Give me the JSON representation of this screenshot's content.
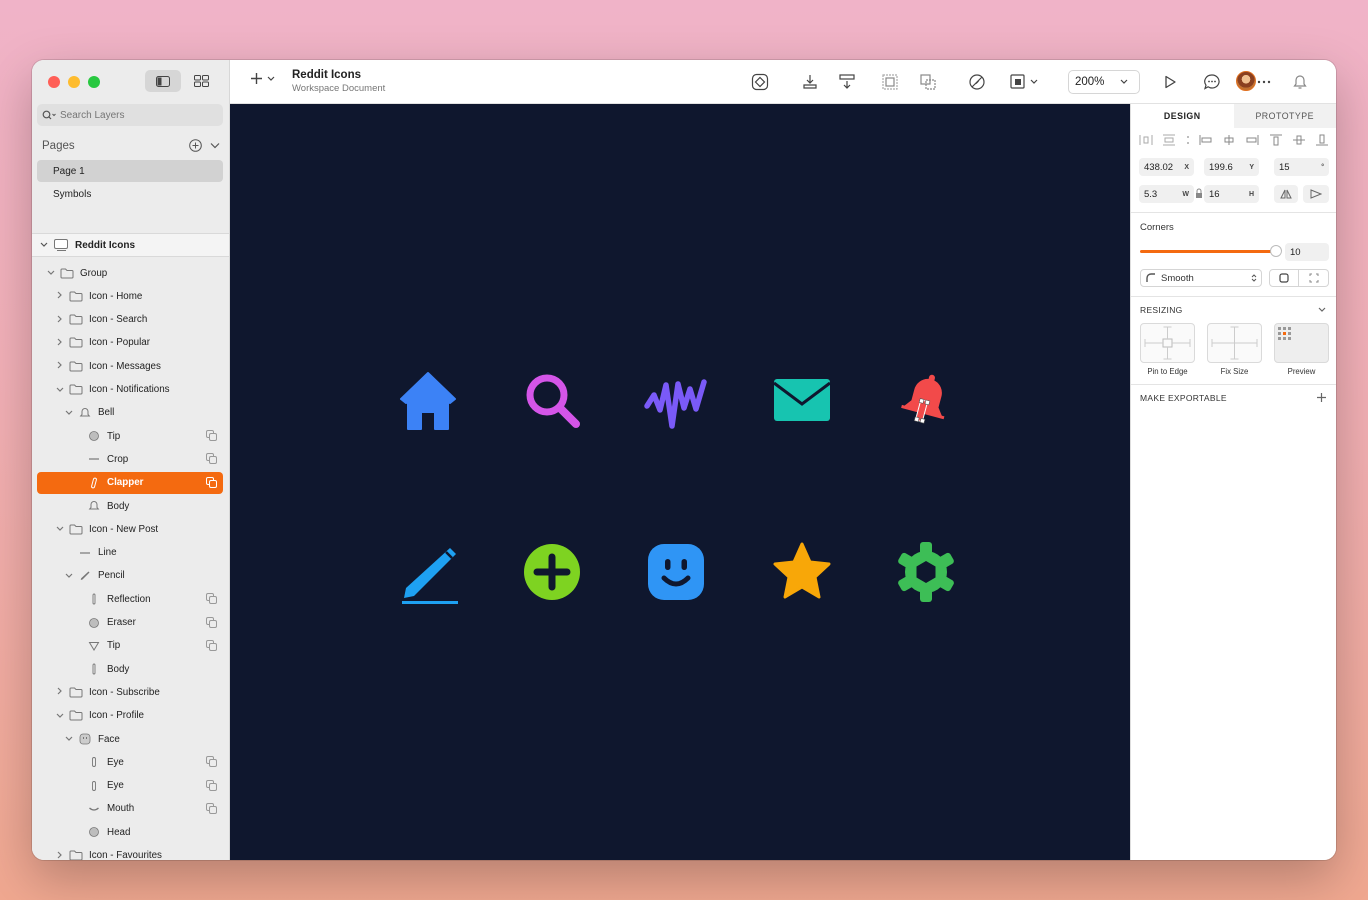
{
  "colors": {
    "accent": "#f46a10",
    "canvas": "#0f172e"
  },
  "sidebar": {
    "search_placeholder": "Search Layers",
    "pages_label": "Pages",
    "pages": [
      {
        "label": "Page 1",
        "selected": true
      },
      {
        "label": "Symbols",
        "selected": false
      }
    ],
    "root_label": "Reddit Icons",
    "layers": [
      {
        "label": "Group",
        "indent": 0,
        "chev": "down",
        "icon": "folder-icon"
      },
      {
        "label": "Icon - Home",
        "indent": 1,
        "chev": "right",
        "icon": "folder-icon"
      },
      {
        "label": "Icon - Search",
        "indent": 1,
        "chev": "right",
        "icon": "folder-icon"
      },
      {
        "label": "Icon - Popular",
        "indent": 1,
        "chev": "right",
        "icon": "folder-icon"
      },
      {
        "label": "Icon - Messages",
        "indent": 1,
        "chev": "right",
        "icon": "folder-icon"
      },
      {
        "label": "Icon - Notifications",
        "indent": 1,
        "chev": "down",
        "icon": "folder-icon"
      },
      {
        "label": "Bell",
        "indent": 2,
        "chev": "down",
        "icon": "bell-icon"
      },
      {
        "label": "Tip",
        "indent": 3,
        "chev": "",
        "icon": "circle-icon",
        "symbol": true
      },
      {
        "label": "Crop",
        "indent": 3,
        "chev": "",
        "icon": "line-icon",
        "symbol": true
      },
      {
        "label": "Clapper",
        "indent": 3,
        "chev": "",
        "icon": "clapper-icon",
        "symbol": true,
        "selected": true
      },
      {
        "label": "Body",
        "indent": 3,
        "chev": "",
        "icon": "bell-icon"
      },
      {
        "label": "Icon - New Post",
        "indent": 1,
        "chev": "down",
        "icon": "folder-icon"
      },
      {
        "label": "Line",
        "indent": 2,
        "chev": "",
        "icon": "line-icon"
      },
      {
        "label": "Pencil",
        "indent": 2,
        "chev": "down",
        "icon": "pencil-icon"
      },
      {
        "label": "Reflection",
        "indent": 3,
        "chev": "",
        "icon": "bar-icon",
        "symbol": true
      },
      {
        "label": "Eraser",
        "indent": 3,
        "chev": "",
        "icon": "circle-icon",
        "symbol": true
      },
      {
        "label": "Tip",
        "indent": 3,
        "chev": "",
        "icon": "triangle-icon",
        "symbol": true
      },
      {
        "label": "Body",
        "indent": 3,
        "chev": "",
        "icon": "bar-icon"
      },
      {
        "label": "Icon - Subscribe",
        "indent": 1,
        "chev": "right",
        "icon": "folder-icon"
      },
      {
        "label": "Icon - Profile",
        "indent": 1,
        "chev": "down",
        "icon": "folder-icon"
      },
      {
        "label": "Face",
        "indent": 2,
        "chev": "down",
        "icon": "face-icon"
      },
      {
        "label": "Eye",
        "indent": 3,
        "chev": "",
        "icon": "eye-icon",
        "symbol": true
      },
      {
        "label": "Eye",
        "indent": 3,
        "chev": "",
        "icon": "eye-icon",
        "symbol": true
      },
      {
        "label": "Mouth",
        "indent": 3,
        "chev": "",
        "icon": "mouth-icon",
        "symbol": true
      },
      {
        "label": "Head",
        "indent": 3,
        "chev": "",
        "icon": "circle-icon"
      },
      {
        "label": "Icon - Favourites",
        "indent": 1,
        "chev": "right",
        "icon": "folder-icon"
      }
    ]
  },
  "toolbar": {
    "title": "Reddit Icons",
    "subtitle": "Workspace Document",
    "zoom": "200%"
  },
  "canvas": {
    "icons": [
      "home-icon",
      "search-icon",
      "popular-icon",
      "messages-icon",
      "notifications-icon",
      "new-post-icon",
      "subscribe-icon",
      "profile-icon",
      "favourites-icon",
      "settings-icon"
    ]
  },
  "inspector": {
    "tab_design": "DESIGN",
    "tab_prototype": "PROTOTYPE",
    "x": "438.02",
    "x_unit": "X",
    "y": "199.6",
    "y_unit": "Y",
    "rotation": "15",
    "rotation_unit": "°",
    "w": "5.3",
    "w_unit": "W",
    "h": "16",
    "h_unit": "H",
    "corners_label": "Corners",
    "corners_value": "10",
    "corner_style": "Smooth",
    "resizing_label": "RESIZING",
    "pin_label": "Pin to Edge",
    "fix_label": "Fix Size",
    "preview_label": "Preview",
    "exportable_label": "MAKE EXPORTABLE"
  }
}
